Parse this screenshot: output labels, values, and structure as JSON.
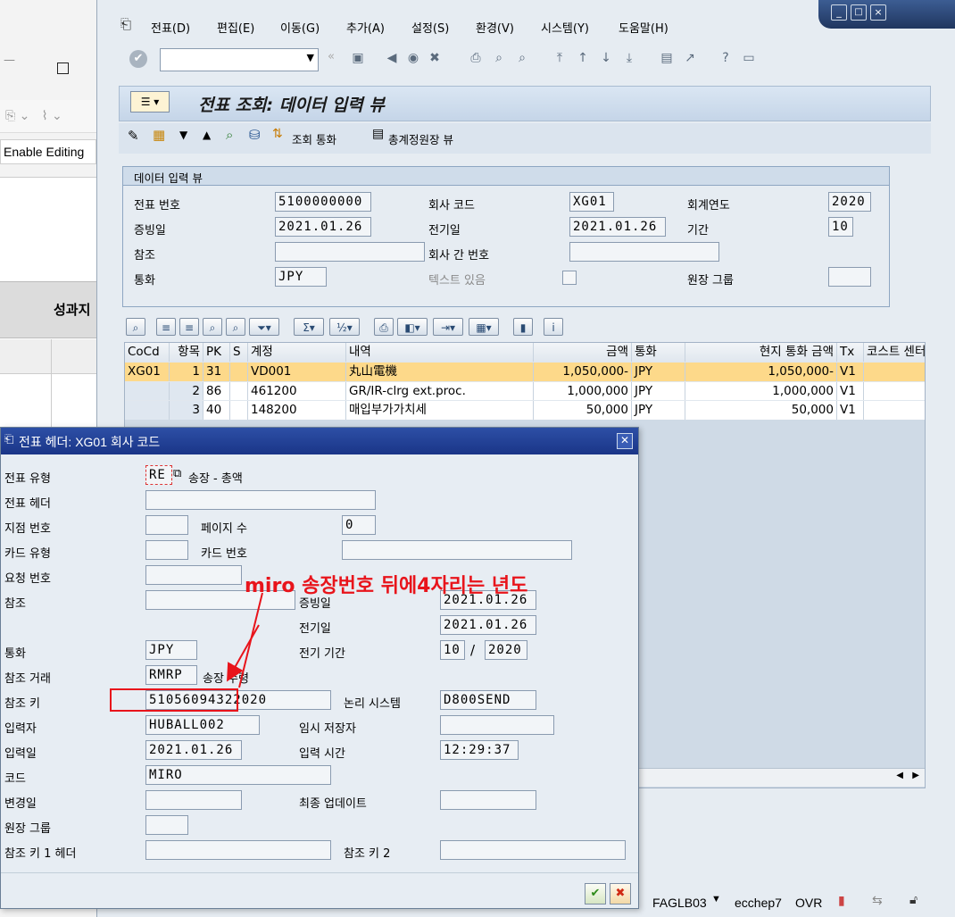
{
  "bg_app": {
    "enable_editing": "Enable Editing",
    "header_partial": "성과지"
  },
  "menu": [
    "전표(D)",
    "편집(E)",
    "이동(G)",
    "추가(A)",
    "설정(S)",
    "환경(V)",
    "시스템(Y)",
    "도움말(H)"
  ],
  "title": "전표 조회: 데이터 입력 뷰",
  "app_toolbar": {
    "currency_btn": "조회 통화",
    "gl_view_btn": "총계정원장 뷰"
  },
  "entry_view": {
    "group_title": "데이터 입력 뷰",
    "labels": {
      "doc_no": "전표 번호",
      "company_code": "회사 코드",
      "fiscal_year": "회계연도",
      "doc_date": "증빙일",
      "posting_date": "전기일",
      "period": "기간",
      "reference": "참조",
      "intercompany": "회사 간 번호",
      "currency": "통화",
      "text_exists": "텍스트 있음",
      "ledger_group": "원장 그룹"
    },
    "values": {
      "doc_no": "5100000000",
      "company_code": "XG01",
      "fiscal_year": "2020",
      "doc_date": "2021.01.26",
      "posting_date": "2021.01.26",
      "period": "10",
      "reference": "",
      "intercompany": "",
      "currency": "JPY",
      "ledger_group": ""
    }
  },
  "grid": {
    "headers": [
      "CoCd",
      "항목",
      "PK",
      "S",
      "계정",
      "내역",
      "금액",
      "통화",
      "현지 통화 금액",
      "Tx",
      "코스트 센터"
    ],
    "rows": [
      {
        "cocd": "XG01",
        "item": "1",
        "pk": "31",
        "s": "",
        "account": "VD001",
        "desc": "丸山電機",
        "amount": "1,050,000-",
        "curr": "JPY",
        "local": "1,050,000-",
        "tx": "V1"
      },
      {
        "cocd": "",
        "item": "2",
        "pk": "86",
        "s": "",
        "account": "461200",
        "desc": "GR/IR-clrg ext.proc.",
        "amount": "1,000,000",
        "curr": "JPY",
        "local": "1,000,000",
        "tx": "V1"
      },
      {
        "cocd": "",
        "item": "3",
        "pk": "40",
        "s": "",
        "account": "148200",
        "desc": "매입부가가치세",
        "amount": "50,000",
        "curr": "JPY",
        "local": "50,000",
        "tx": "V1"
      }
    ]
  },
  "dialog": {
    "title": "전표 헤더: XG01 회사 코드",
    "labels": {
      "doc_type": "전표 유형",
      "doc_type_desc": "송장 - 총액",
      "doc_header": "전표 헤더",
      "branch_no": "지점 번호",
      "pages": "페이지 수",
      "card_type": "카드 유형",
      "card_no": "카드 번호",
      "request_no": "요청 번호",
      "reference": "참조",
      "doc_date": "증빙일",
      "posting_date": "전기일",
      "currency": "통화",
      "posting_period": "전기 기간",
      "ref_trans": "참조 거래",
      "ref_trans_desc": "송장 수령",
      "ref_key": "참조 키",
      "logical_system": "논리 시스템",
      "entered_by": "입력자",
      "parked_by": "임시 저장자",
      "entry_date": "입력일",
      "entry_time": "입력 시간",
      "tcode": "코드",
      "changed_on": "변경일",
      "last_update": "최종 업데이트",
      "ledger_group": "원장 그룹",
      "ref_key1": "참조 키 1 헤더",
      "ref_key2": "참조 키 2"
    },
    "values": {
      "doc_type": "RE",
      "doc_header": "",
      "branch_no": "",
      "pages": "0",
      "card_type": "",
      "card_no": "",
      "request_no": "",
      "reference": "",
      "doc_date": "2021.01.26",
      "posting_date": "2021.01.26",
      "currency": "JPY",
      "period": "10",
      "period_sep": "/",
      "year": "2020",
      "ref_trans": "RMRP",
      "ref_key": "51056094322020",
      "logical_system": "D800SEND",
      "entered_by": "HUBALL002",
      "parked_by": "",
      "entry_date": "2021.01.26",
      "entry_time": "12:29:37",
      "tcode": "MIRO",
      "changed_on": "",
      "last_update": "",
      "ledger_group": "",
      "ref_key1": "",
      "ref_key2": ""
    }
  },
  "annotation": {
    "text": "miro 송장번호 뒤에4자리는 년도",
    "color": "#e8141b"
  },
  "status_bar": {
    "program": "FAGLB03",
    "server": "ecchep7",
    "mode": "OVR"
  },
  "colors": {
    "selected_row": "#fdd98a",
    "dialog_title_bg": "#1f3a93"
  }
}
